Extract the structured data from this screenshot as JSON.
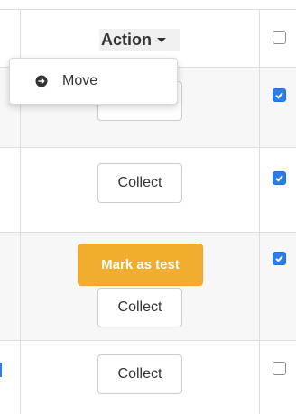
{
  "table": {
    "header": {
      "action_label": "Action"
    },
    "rows": [
      {
        "collect_label": "Collect",
        "checked": true
      },
      {
        "collect_label": "Collect",
        "checked": true
      },
      {
        "mark_label": "Mark as test",
        "collect_label": "Collect",
        "checked": true
      },
      {
        "collect_label": "Collect",
        "checked": false
      }
    ]
  },
  "dropdown": {
    "items": [
      {
        "label": "Move",
        "icon": "arrow-circle-right-icon"
      }
    ]
  },
  "colors": {
    "checkbox_checked": "#2b7de9",
    "mark_test_button": "#f0ad2e",
    "row_stripe": "#f7f7f7",
    "grid_line": "#dddddd"
  }
}
